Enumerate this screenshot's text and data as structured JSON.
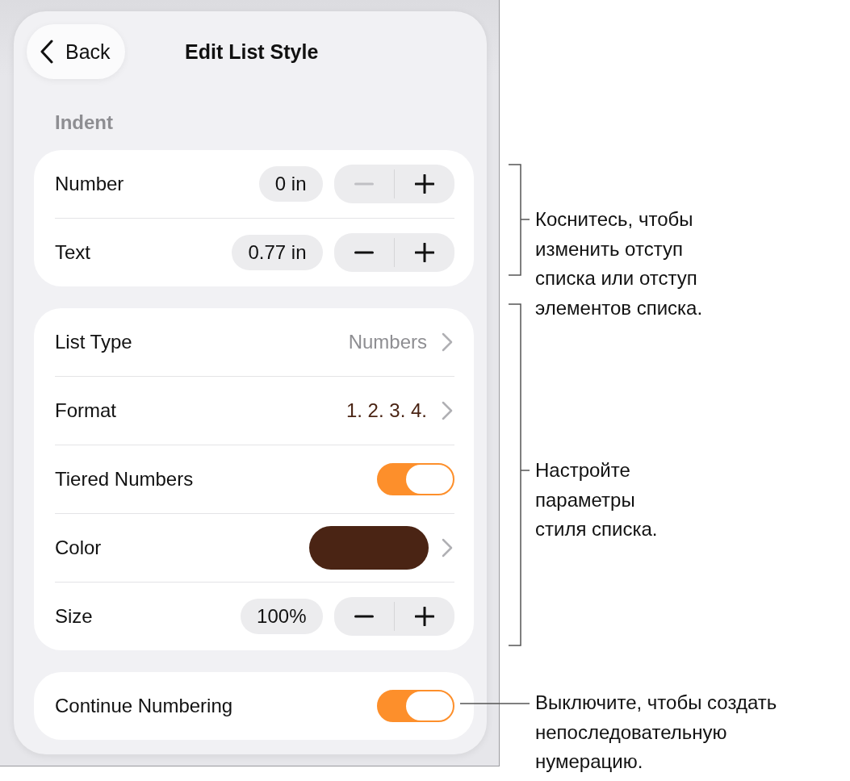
{
  "header": {
    "back_label": "Back",
    "title": "Edit List Style"
  },
  "section_label": "Indent",
  "groups": [
    {
      "rows": [
        {
          "kind": "stepper",
          "label": "Number",
          "value": "0 in",
          "minus_disabled": true,
          "plus_disabled": false
        },
        {
          "kind": "stepper",
          "label": "Text",
          "value": "0.77 in",
          "minus_disabled": false,
          "plus_disabled": false
        }
      ]
    },
    {
      "rows": [
        {
          "kind": "link",
          "label": "List Type",
          "value": "Numbers"
        },
        {
          "kind": "format",
          "label": "Format",
          "value": "1. 2. 3. 4."
        },
        {
          "kind": "toggle",
          "label": "Tiered Numbers",
          "on": true
        },
        {
          "kind": "color",
          "label": "Color",
          "color": "#4a2414"
        },
        {
          "kind": "stepper",
          "label": "Size",
          "value": "100%",
          "minus_disabled": false,
          "plus_disabled": false
        }
      ]
    },
    {
      "rows": [
        {
          "kind": "toggle",
          "label": "Continue Numbering",
          "on": true
        }
      ]
    }
  ],
  "callouts": [
    {
      "kind": "bracket",
      "lines": [
        "Коснитесь, чтобы",
        "изменить отступ",
        "списка или отступ",
        "элементов списка."
      ]
    },
    {
      "kind": "bracket",
      "lines": [
        "Настройте",
        "параметры",
        "стиля списка."
      ]
    },
    {
      "kind": "line",
      "lines": [
        "Выключите, чтобы создать",
        "непоследовательную",
        "нумерацию."
      ]
    }
  ]
}
